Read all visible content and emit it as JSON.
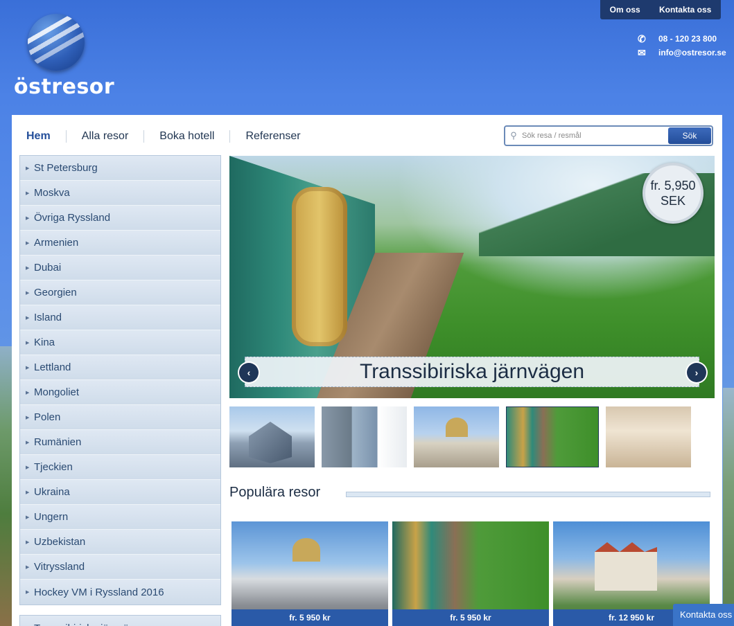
{
  "top_links": [
    "Om oss",
    "Kontakta oss"
  ],
  "brand": {
    "name": "östresor"
  },
  "contact": {
    "phone": "08 - 120 23 800",
    "email": "info@ostresor.se"
  },
  "nav": {
    "items": [
      "Hem",
      "Alla resor",
      "Boka hotell",
      "Referenser"
    ]
  },
  "search": {
    "placeholder": "Sök resa / resmål",
    "button": "Sök"
  },
  "sidebar": {
    "destinations": [
      "St Petersburg",
      "Moskva",
      "Övriga Ryssland",
      "Armenien",
      "Dubai",
      "Georgien",
      "Island",
      "Kina",
      "Lettland",
      "Mongoliet",
      "Polen",
      "Rumänien",
      "Tjeckien",
      "Ukraina",
      "Ungern",
      "Uzbekistan",
      "Vitryssland",
      "Hockey VM i Ryssland 2016"
    ],
    "trips": [
      "Transsibiriska järnvägen"
    ]
  },
  "slider": {
    "caption": "Transsibiriska järnvägen",
    "price_line1": "fr. 5,950",
    "price_line2": "SEK",
    "active_thumb": 4
  },
  "popular": {
    "title": "Populära resor",
    "cards": [
      {
        "price": "fr. 5 950 kr"
      },
      {
        "price": "fr. 5 950 kr"
      },
      {
        "price": "fr. 12 950 kr"
      }
    ]
  },
  "float_contact": "Kontakta oss",
  "colors": {
    "accent": "#2a5aa8",
    "dark": "#1e3a6e",
    "sidebar": "#d6e2ef"
  }
}
